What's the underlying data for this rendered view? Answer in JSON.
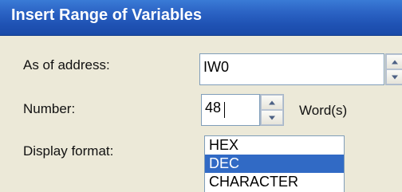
{
  "window": {
    "title": "Insert Range of Variables"
  },
  "form": {
    "address_label": "As of address:",
    "address_value": "IW0",
    "number_label": "Number:",
    "number_value": "48",
    "number_unit": "Word(s)",
    "format_label": "Display format:",
    "format_options": [
      "HEX",
      "DEC",
      "CHARACTER"
    ],
    "format_selected": "DEC"
  },
  "colors": {
    "titlebar": "#2b63c4",
    "selection": "#316ac5"
  },
  "icons": {
    "spin_up": "triangle-up",
    "spin_down": "triangle-down"
  }
}
